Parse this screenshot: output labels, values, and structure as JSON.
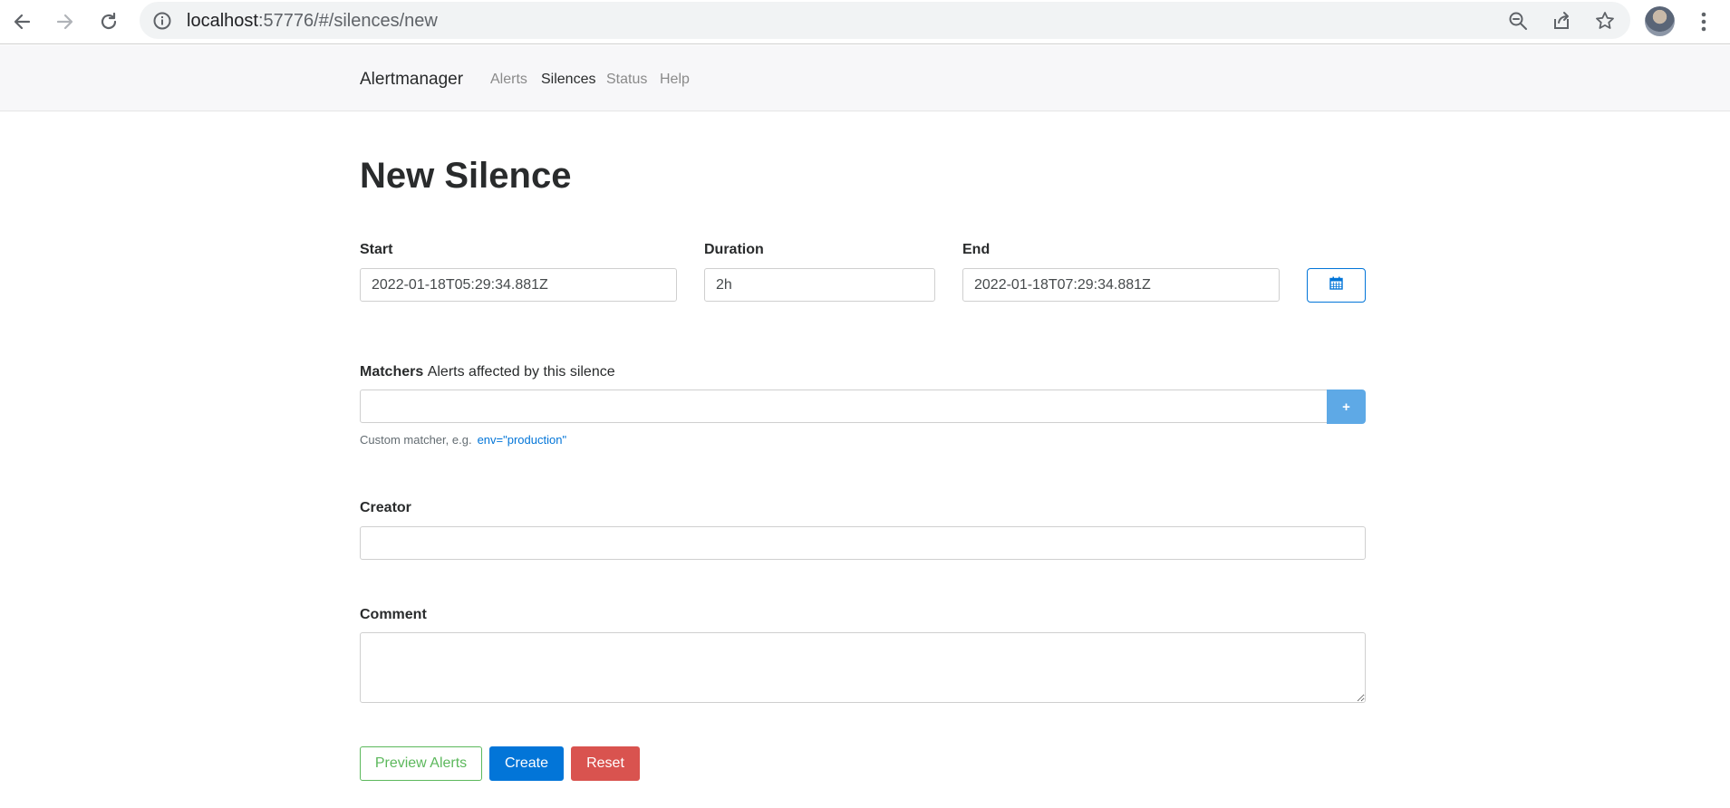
{
  "browser": {
    "url_host": "localhost",
    "url_path": ":57776/#/silences/new"
  },
  "navbar": {
    "brand": "Alertmanager",
    "links": [
      {
        "label": "Alerts",
        "active": false
      },
      {
        "label": "Silences",
        "active": true
      },
      {
        "label": "Status",
        "active": false
      },
      {
        "label": "Help",
        "active": false
      }
    ]
  },
  "page": {
    "title": "New Silence"
  },
  "form": {
    "start": {
      "label": "Start",
      "value": "2022-01-18T05:29:34.881Z"
    },
    "duration": {
      "label": "Duration",
      "value": "2h"
    },
    "end": {
      "label": "End",
      "value": "2022-01-18T07:29:34.881Z"
    },
    "matchers": {
      "label": "Matchers",
      "sublabel": "Alerts affected by this silence",
      "value": "",
      "add_label": "+",
      "hint": "Custom matcher, e.g.",
      "hint_example": "env=\"production\""
    },
    "creator": {
      "label": "Creator",
      "value": ""
    },
    "comment": {
      "label": "Comment",
      "value": ""
    }
  },
  "actions": {
    "preview": "Preview Alerts",
    "create": "Create",
    "reset": "Reset"
  },
  "colors": {
    "primary": "#0275d8",
    "success": "#5cb85c",
    "danger": "#d9534f",
    "navbar_bg": "#f7f7f9"
  },
  "icons": [
    "back-arrow-icon",
    "forward-arrow-icon",
    "reload-icon",
    "info-icon",
    "zoom-icon",
    "share-icon",
    "star-icon",
    "kebab-menu-icon",
    "calendar-icon"
  ]
}
